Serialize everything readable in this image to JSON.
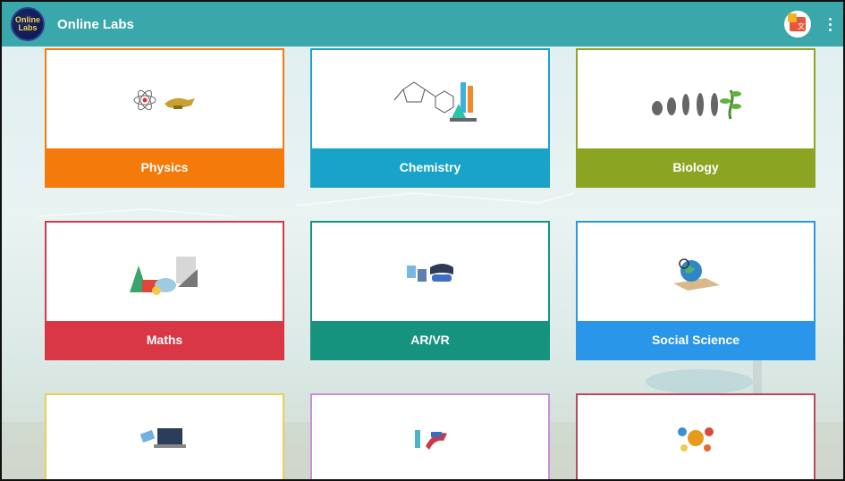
{
  "app": {
    "logo_top": "Online",
    "logo_bottom": "Labs",
    "title": "Online Labs"
  },
  "subjects": [
    {
      "label": "Physics",
      "color": "#f47a0c"
    },
    {
      "label": "Chemistry",
      "color": "#1aa3c9"
    },
    {
      "label": "Biology",
      "color": "#8ba523"
    },
    {
      "label": "Maths",
      "color": "#d93745"
    },
    {
      "label": "AR/VR",
      "color": "#15937f"
    },
    {
      "label": "Social Science",
      "color": "#2a96ea"
    }
  ],
  "icons": {
    "translate": "translate-icon",
    "menu": "more-vert-icon"
  }
}
